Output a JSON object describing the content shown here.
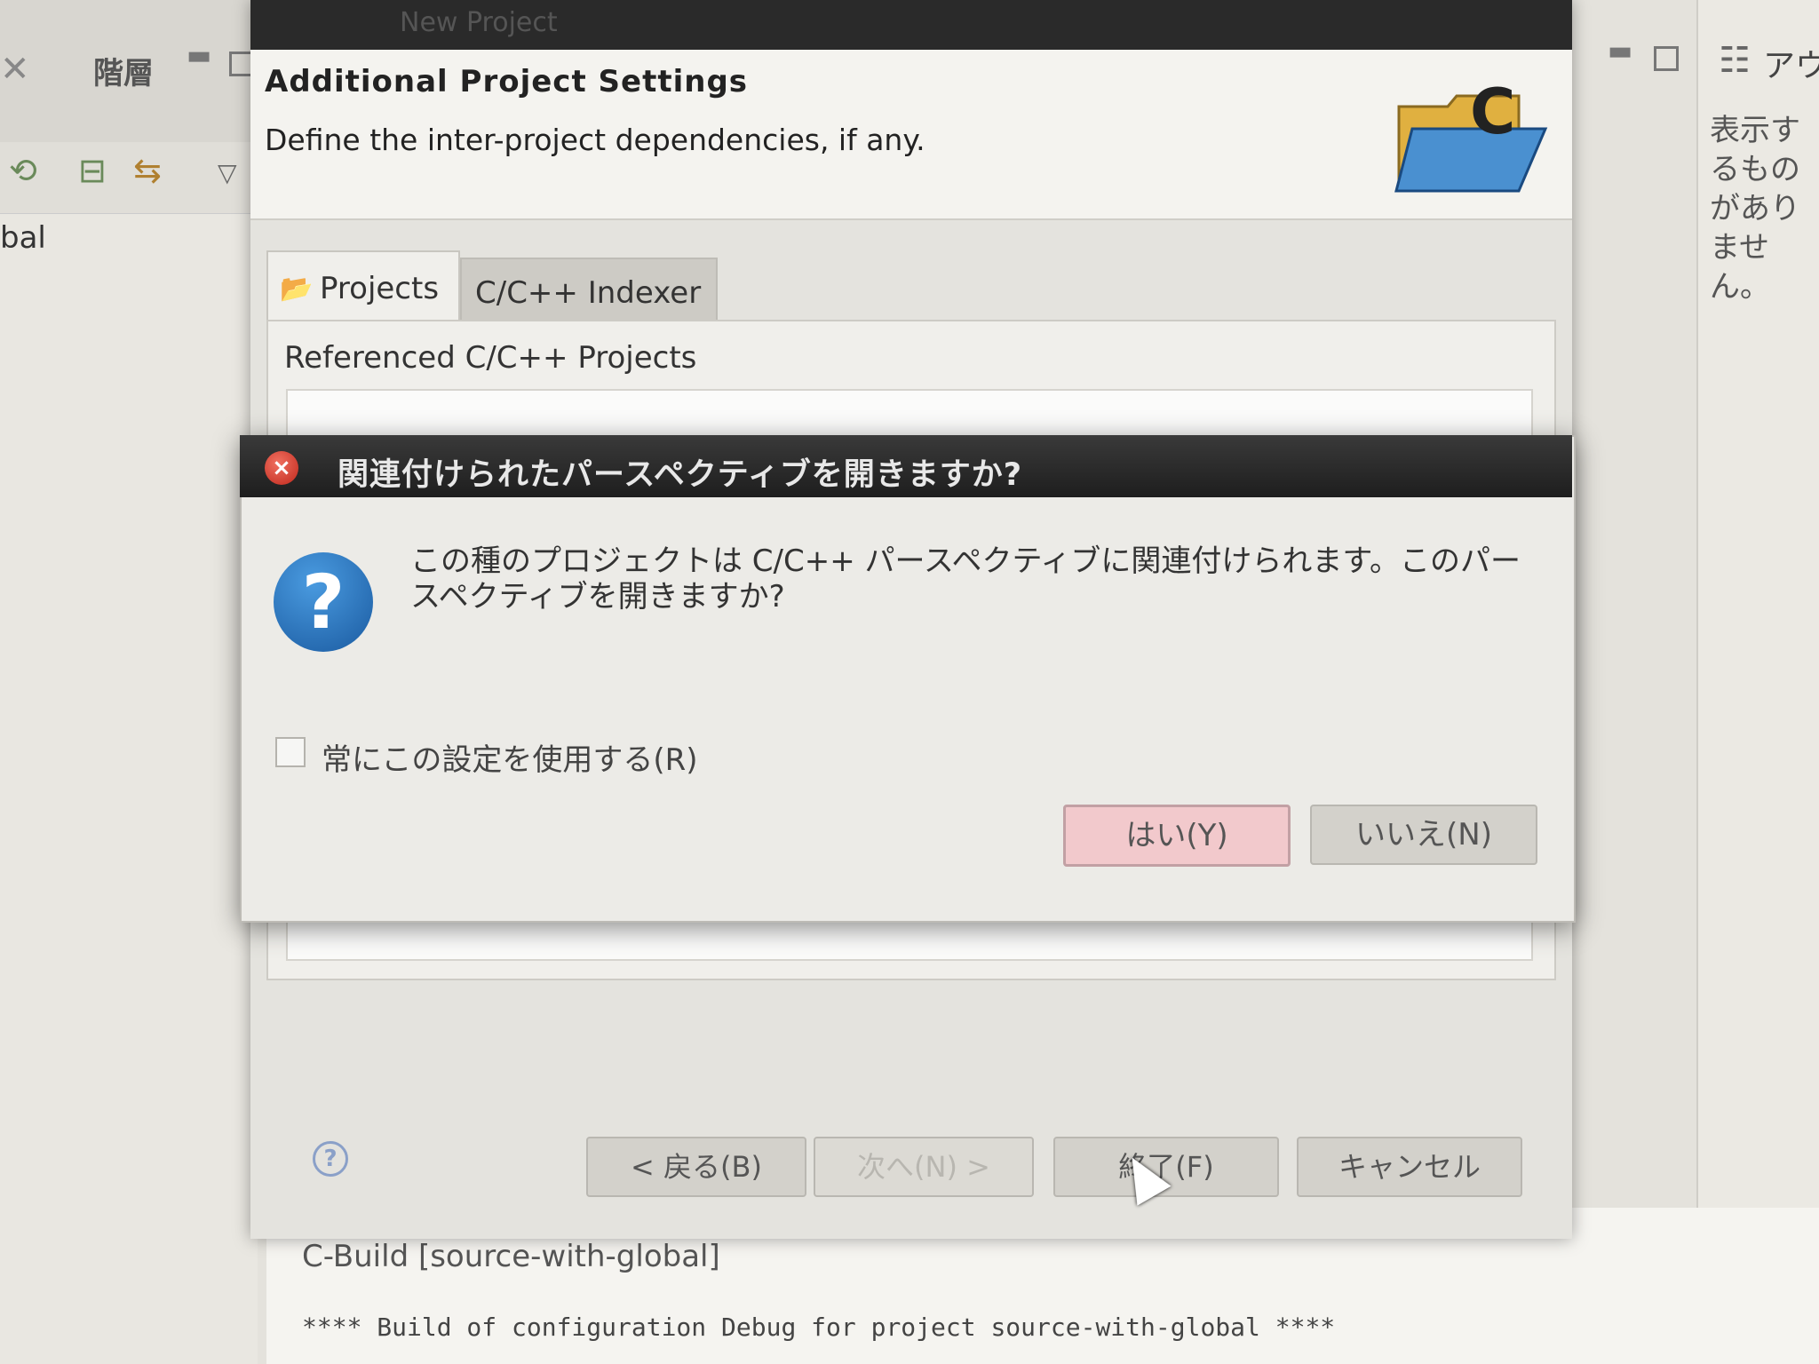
{
  "ide": {
    "left_tab_close": "✕",
    "left_tab_label": "階層",
    "tree_item": "bal",
    "outline_label": "アウ",
    "outline_message": "表示するものがありません。",
    "console_tab": "C-Build [source-with-global]",
    "console_line": "**** Build of configuration Debug for project source-with-global ****"
  },
  "wizard": {
    "title": "New Project",
    "header_title": "Additional Project Settings",
    "header_desc": "Define the inter-project dependencies, if any.",
    "tabs": [
      {
        "label": "Projects"
      },
      {
        "label": "C/C++ Indexer"
      }
    ],
    "referenced_label": "Referenced C/C++ Projects",
    "buttons": {
      "back": "< 戻る(B)",
      "next": "次へ(N) >",
      "finish": "終了(F)",
      "cancel": "キャンセル"
    }
  },
  "modal": {
    "title": "関連付けられたパースペクティブを開きますか?",
    "message": "この種のプロジェクトは C/C++ パースペクティブに関連付けられます。このパースペクティブを開きますか?",
    "checkbox_label": "常にこの設定を使用する(R)",
    "yes": "はい(Y)",
    "no": "いいえ(N)"
  },
  "icons": {
    "close": "close-icon",
    "question": "question-icon",
    "folder": "folder-icon",
    "help": "help-icon"
  },
  "colors": {
    "yes_button": "#f2c9cc",
    "modal_titlebar": "#1e1e1e",
    "question_icon": "#1a5aa0"
  }
}
